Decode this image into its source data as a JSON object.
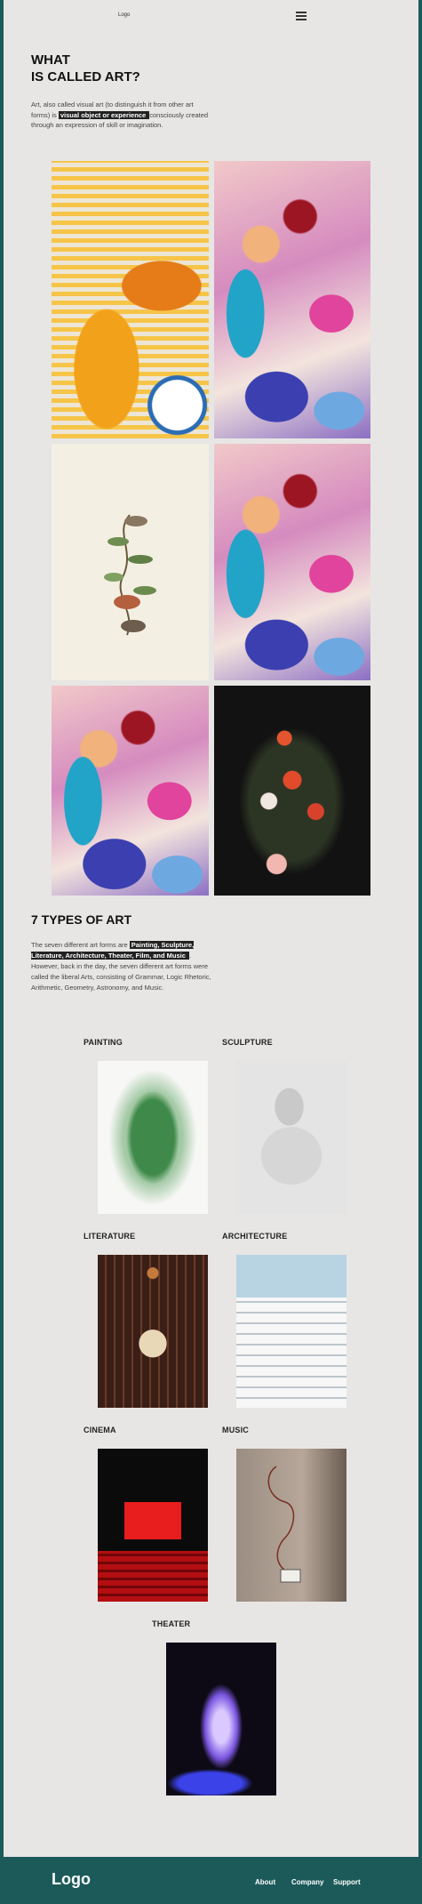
{
  "header": {
    "logo": "Logo",
    "menu_icon": "hamburger-menu-icon"
  },
  "hero": {
    "title": "WHAT\nIS CALLED ART?",
    "intro_before": "Art, also called visual art (to distinguish it from other art forms) is ",
    "intro_highlight": " visual object or experience ",
    "intro_after": " consciously created through an expression of skill or imagination."
  },
  "types": {
    "title": "7 TYPES OF ART",
    "text_before": "The seven different art forms are ",
    "text_highlight": " Painting, Sculpture, Literature, Architecture, Theater, Film, and Music ",
    "text_after": ". However, back in the day, the seven different art forms were called the liberal Arts, consisting of Grammar, Logic Rhetoric, Arithmetic, Geometry, Astronomy, and Music.",
    "categories": [
      "PAINTING",
      "SCULPTURE",
      "LITERATURE",
      "ARCHITECTURE",
      "CINEMA",
      "MUSIC",
      "THEATER"
    ]
  },
  "footer": {
    "logo": "Logo",
    "links": [
      "About",
      "Company",
      "Support"
    ]
  },
  "colors": {
    "frame": "#1c5a5a",
    "page_bg": "#e7e6e5",
    "highlight_bg": "#222222"
  }
}
